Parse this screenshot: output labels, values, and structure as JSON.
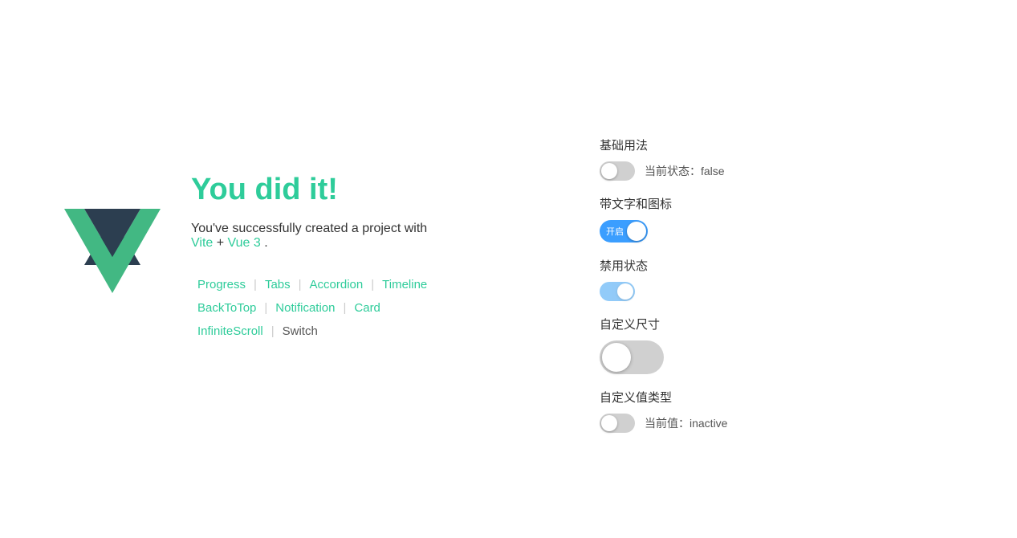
{
  "headline": "You did it!",
  "subtitle": {
    "text": "You've successfully created a project with",
    "link1": "Vite",
    "plus": " + ",
    "link2": "Vue 3",
    "period": "."
  },
  "links": [
    {
      "label": "Progress",
      "type": "link"
    },
    {
      "label": "|",
      "type": "sep"
    },
    {
      "label": "Tabs",
      "type": "link"
    },
    {
      "label": "|",
      "type": "sep"
    },
    {
      "label": "Accordion",
      "type": "link"
    },
    {
      "label": "|",
      "type": "sep"
    },
    {
      "label": "Timeline",
      "type": "link"
    },
    {
      "label": "BackToTop",
      "type": "link"
    },
    {
      "label": "|",
      "type": "sep"
    },
    {
      "label": "Notification",
      "type": "link"
    },
    {
      "label": "|",
      "type": "sep"
    },
    {
      "label": "Card",
      "type": "link"
    },
    {
      "label": "InfiniteScroll",
      "type": "link"
    },
    {
      "label": "|",
      "type": "sep"
    },
    {
      "label": "Switch",
      "type": "plain"
    }
  ],
  "right_panel": {
    "sections": [
      {
        "id": "basic",
        "title": "基础用法",
        "status_label": "当前状态：false",
        "toggle_state": "off"
      },
      {
        "id": "text-icon",
        "title": "带文字和图标",
        "toggle_state": "on",
        "toggle_label": "开启"
      },
      {
        "id": "disabled",
        "title": "禁用状态",
        "toggle_state": "on-disabled"
      },
      {
        "id": "custom-size",
        "title": "自定义尺寸",
        "toggle_state": "off-large"
      },
      {
        "id": "custom-value",
        "title": "自定义值类型",
        "status_label": "当前值：inactive",
        "toggle_state": "off"
      }
    ]
  }
}
